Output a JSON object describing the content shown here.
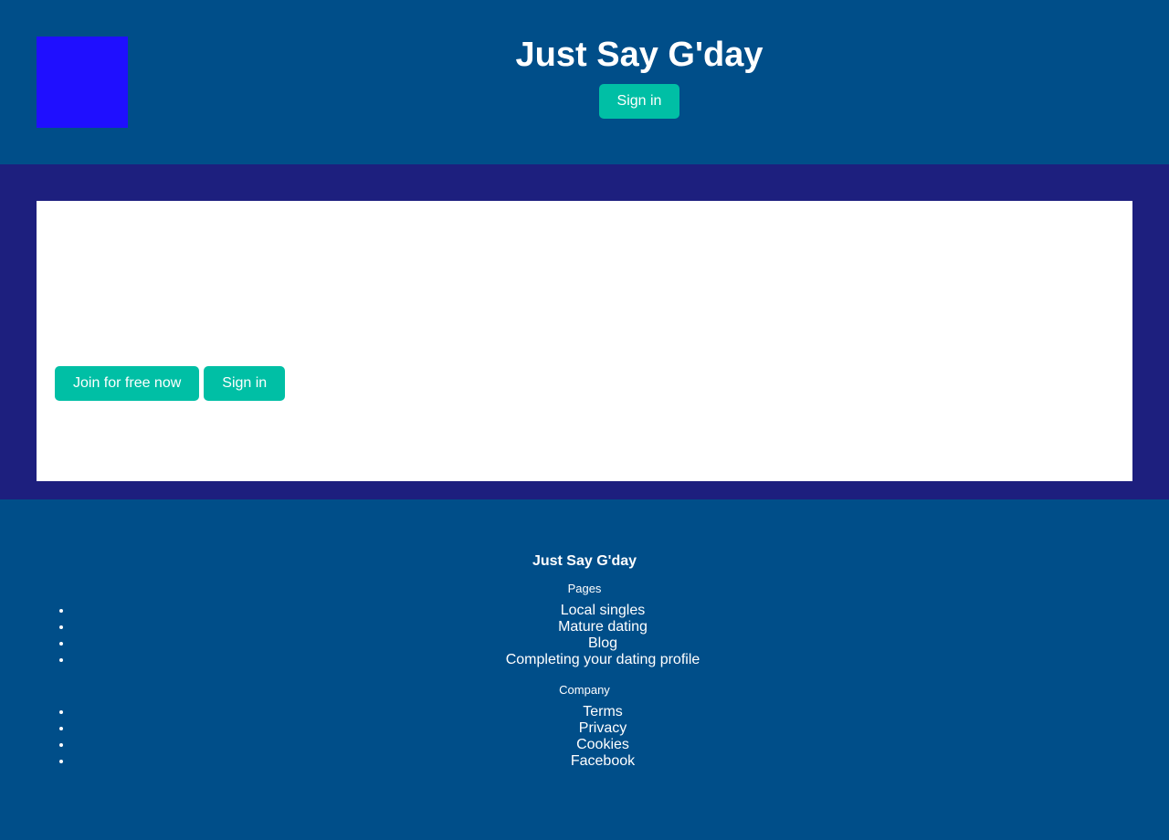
{
  "header": {
    "title": "Just Say G'day",
    "sign_in_label": "Sign in",
    "logo_color": "#1f0fff"
  },
  "hero": {
    "join_label": "Join for free now",
    "sign_in_label": "Sign in"
  },
  "footer": {
    "brand": "Just Say G'day",
    "pages_heading": "Pages",
    "pages": [
      "Local singles",
      "Mature dating",
      "Blog",
      "Completing your dating profile"
    ],
    "company_heading": "Company",
    "company": [
      "Terms",
      "Privacy",
      "Cookies",
      "Facebook"
    ]
  },
  "colors": {
    "header_bg": "#004e89",
    "hero_bg": "#1d1f7e",
    "button": "#00bfa5"
  }
}
